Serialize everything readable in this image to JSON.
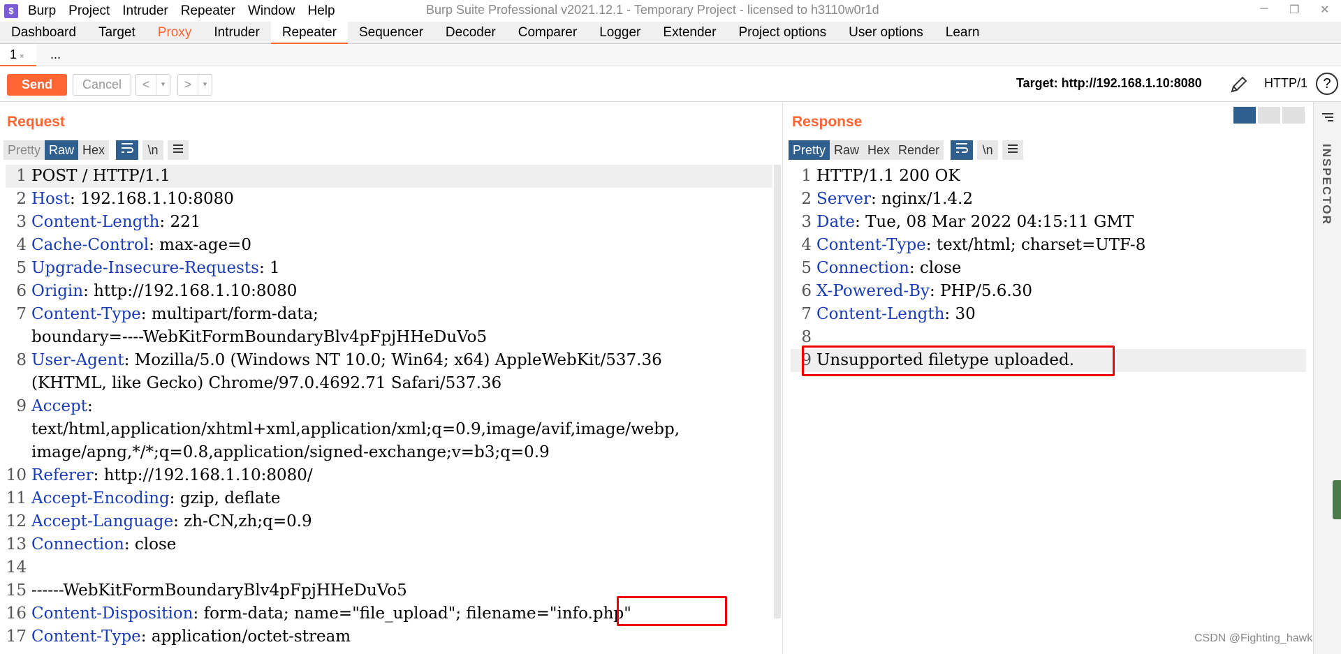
{
  "window": {
    "title": "Burp Suite Professional v2021.12.1 - Temporary Project - licensed to h3110w0r1d",
    "logo": "$",
    "minimize": "─",
    "restore": "❐",
    "close": "✕"
  },
  "menu": [
    "Burp",
    "Project",
    "Intruder",
    "Repeater",
    "Window",
    "Help"
  ],
  "module_tabs": [
    "Dashboard",
    "Target",
    "Proxy",
    "Intruder",
    "Repeater",
    "Sequencer",
    "Decoder",
    "Comparer",
    "Logger",
    "Extender",
    "Project options",
    "User options",
    "Learn"
  ],
  "sub_tabs": {
    "tab1": "1",
    "tab1_close": "×",
    "more": "..."
  },
  "toolbar": {
    "send": "Send",
    "cancel": "Cancel",
    "back": "<",
    "forward": ">",
    "dropdown": "▾",
    "target": "Target: http://192.168.1.10:8080",
    "protocol": "HTTP/1",
    "help": "?"
  },
  "request": {
    "title": "Request",
    "views": [
      "Pretty",
      "Raw",
      "Hex"
    ],
    "selected_view": "Raw",
    "newline_btn": "\\n",
    "lines": [
      {
        "n": "1",
        "name": "",
        "value": "POST / HTTP/1.1"
      },
      {
        "n": "2",
        "name": "Host",
        "value": ": 192.168.1.10:8080"
      },
      {
        "n": "3",
        "name": "Content-Length",
        "value": ": 221"
      },
      {
        "n": "4",
        "name": "Cache-Control",
        "value": ": max-age=0"
      },
      {
        "n": "5",
        "name": "Upgrade-Insecure-Requests",
        "value": ": 1"
      },
      {
        "n": "6",
        "name": "Origin",
        "value": ": http://192.168.1.10:8080"
      },
      {
        "n": "7",
        "name": "Content-Type",
        "value": ": multipart/form-data;"
      },
      {
        "n": "",
        "name": "",
        "value": "boundary=----WebKitFormBoundaryBlv4pFpjHHeDuVo5"
      },
      {
        "n": "8",
        "name": "User-Agent",
        "value": ": Mozilla/5.0 (Windows NT 10.0; Win64; x64) AppleWebKit/537.36"
      },
      {
        "n": "",
        "name": "",
        "value": "(KHTML, like Gecko) Chrome/97.0.4692.71 Safari/537.36"
      },
      {
        "n": "9",
        "name": "Accept",
        "value": ":"
      },
      {
        "n": "",
        "name": "",
        "value": "text/html,application/xhtml+xml,application/xml;q=0.9,image/avif,image/webp,"
      },
      {
        "n": "",
        "name": "",
        "value": "image/apng,*/*;q=0.8,application/signed-exchange;v=b3;q=0.9"
      },
      {
        "n": "10",
        "name": "Referer",
        "value": ": http://192.168.1.10:8080/"
      },
      {
        "n": "11",
        "name": "Accept-Encoding",
        "value": ": gzip, deflate"
      },
      {
        "n": "12",
        "name": "Accept-Language",
        "value": ": zh-CN,zh;q=0.9"
      },
      {
        "n": "13",
        "name": "Connection",
        "value": ": close"
      },
      {
        "n": "14",
        "name": "",
        "value": ""
      },
      {
        "n": "15",
        "name": "",
        "value": "------WebKitFormBoundaryBlv4pFpjHHeDuVo5"
      },
      {
        "n": "16",
        "name": "Content-Disposition",
        "value": ": form-data; name=\"file_upload\"; filename=\"info.php\""
      },
      {
        "n": "17",
        "name": "Content-Type",
        "value": ": application/octet-stream"
      }
    ]
  },
  "response": {
    "title": "Response",
    "views": [
      "Pretty",
      "Raw",
      "Hex",
      "Render"
    ],
    "selected_view": "Pretty",
    "newline_btn": "\\n",
    "lines": [
      {
        "n": "1",
        "name": "",
        "value": "HTTP/1.1 200 OK"
      },
      {
        "n": "2",
        "name": "Server",
        "value": ": nginx/1.4.2"
      },
      {
        "n": "3",
        "name": "Date",
        "value": ": Tue, 08 Mar 2022 04:15:11 GMT"
      },
      {
        "n": "4",
        "name": "Content-Type",
        "value": ": text/html; charset=UTF-8"
      },
      {
        "n": "5",
        "name": "Connection",
        "value": ": close"
      },
      {
        "n": "6",
        "name": "X-Powered-By",
        "value": ": PHP/5.6.30"
      },
      {
        "n": "7",
        "name": "Content-Length",
        "value": ": 30"
      },
      {
        "n": "8",
        "name": "",
        "value": ""
      },
      {
        "n": "9",
        "name": "",
        "value": "Unsupported filetype uploaded."
      }
    ]
  },
  "inspector": {
    "label": "INSPECTOR"
  },
  "watermark": "CSDN @Fighting_hawk",
  "colors": {
    "accent": "#ff6633",
    "header_name": "#1a3cb5",
    "selected_view": "#2f5f8f",
    "highlight": "#e00000"
  }
}
